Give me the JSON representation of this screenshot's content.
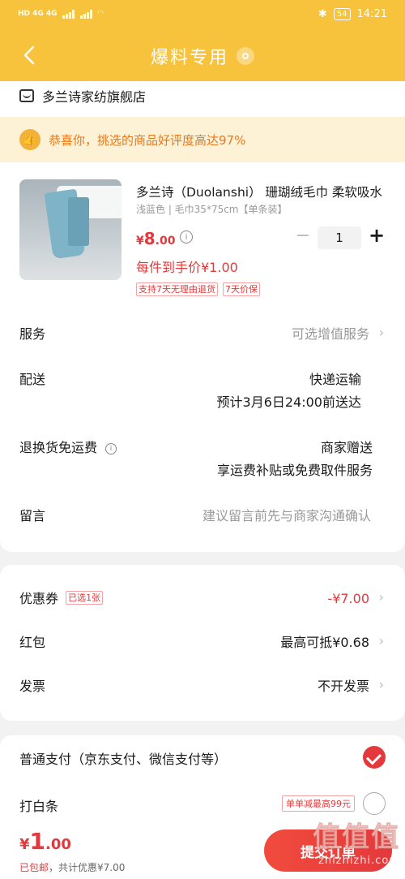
{
  "status_bar": {
    "left": "HD 4G 4G",
    "battery": "54",
    "time": "14:21"
  },
  "header": {
    "title": "爆料专用"
  },
  "shop": {
    "name": "多兰诗家纺旗舰店"
  },
  "banner": {
    "text": "恭喜你，挑选的商品好评度高达97%"
  },
  "product": {
    "title": "多兰诗（Duolanshi） 珊瑚绒毛巾 柔软吸水",
    "spec": "浅蓝色 | 毛巾35*75cm【单条装】",
    "price_symbol": "¥",
    "price_int": "8",
    "price_dec": ".00",
    "quantity": "1",
    "unit_price": "每件到手价¥1.00",
    "tags": [
      "支持7天无理由退货",
      "7天价保"
    ]
  },
  "rows": {
    "service": {
      "label": "服务",
      "value": "可选增值服务"
    },
    "delivery": {
      "label": "配送",
      "value1": "快递运输",
      "value2": "预计3月6日24:00前送达"
    },
    "return_shipping": {
      "label": "退换货免运费",
      "value1": "商家赠送",
      "value2": "享运费补贴或免费取件服务"
    },
    "note": {
      "label": "留言",
      "placeholder": "建议留言前先与商家沟通确认"
    }
  },
  "discounts": {
    "coupon": {
      "label": "优惠券",
      "badge": "已选1张",
      "value": "-¥7.00"
    },
    "red_packet": {
      "label": "红包",
      "value": "最高可抵¥0.68"
    },
    "invoice": {
      "label": "发票",
      "value": "不开发票"
    }
  },
  "payment": {
    "normal": {
      "label": "普通支付（京东支付、微信支付等）",
      "selected": true
    },
    "baitiao": {
      "label": "打白条",
      "promo": "单单减最高99元",
      "selected": false
    }
  },
  "bottom": {
    "total_symbol": "¥",
    "total_int": "1",
    "total_dec": ".00",
    "shipping": "已包邮",
    "discount": "，共计优惠¥7.00",
    "submit": "提交订单"
  },
  "watermark": {
    "logo": "值值值",
    "url": "zhizhizhi.com"
  },
  "colors": {
    "brand_yellow": "#f7c23c",
    "accent_red": "#e4393c"
  }
}
